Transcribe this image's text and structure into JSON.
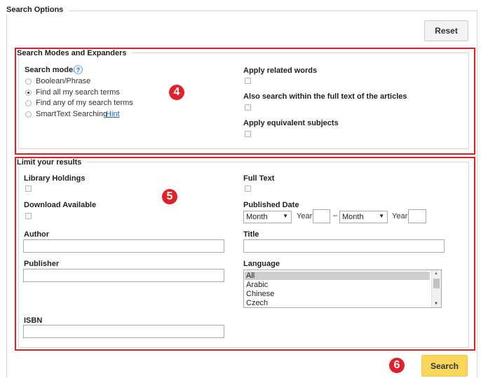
{
  "search_options": {
    "title": "Search Options",
    "reset_label": "Reset",
    "search_label": "Search"
  },
  "modes": {
    "title": "Search Modes and Expanders",
    "search_modes_label": "Search modes",
    "help_glyph": "?",
    "options": [
      {
        "label": "Boolean/Phrase",
        "checked": false
      },
      {
        "label": "Find all my search terms",
        "checked": true
      },
      {
        "label": "Find any of my search terms",
        "checked": false
      },
      {
        "label": "SmartText Searching",
        "checked": false
      }
    ],
    "hint_label": "Hint",
    "apply_related_words": "Apply related words",
    "also_search_full_text": "Also search within the full text of the articles",
    "apply_equivalent_subjects": "Apply equivalent subjects"
  },
  "limits": {
    "title": "Limit your results",
    "library_holdings": "Library Holdings",
    "full_text": "Full Text",
    "download_available": "Download Available",
    "published_date": "Published Date",
    "month_from": "Month",
    "year_label": "Year:",
    "dash": "–",
    "month_to": "Month",
    "author": "Author",
    "title_label": "Title",
    "publisher": "Publisher",
    "language": "Language",
    "language_options": [
      "All",
      "Arabic",
      "Chinese",
      "Czech"
    ],
    "isbn": "ISBN"
  },
  "badges": {
    "b4": "4",
    "b5": "5",
    "b6": "6"
  },
  "colors": {
    "annotation_red": "#e0202b",
    "search_button": "#f9d65a",
    "link_blue": "#1a5fb4"
  }
}
